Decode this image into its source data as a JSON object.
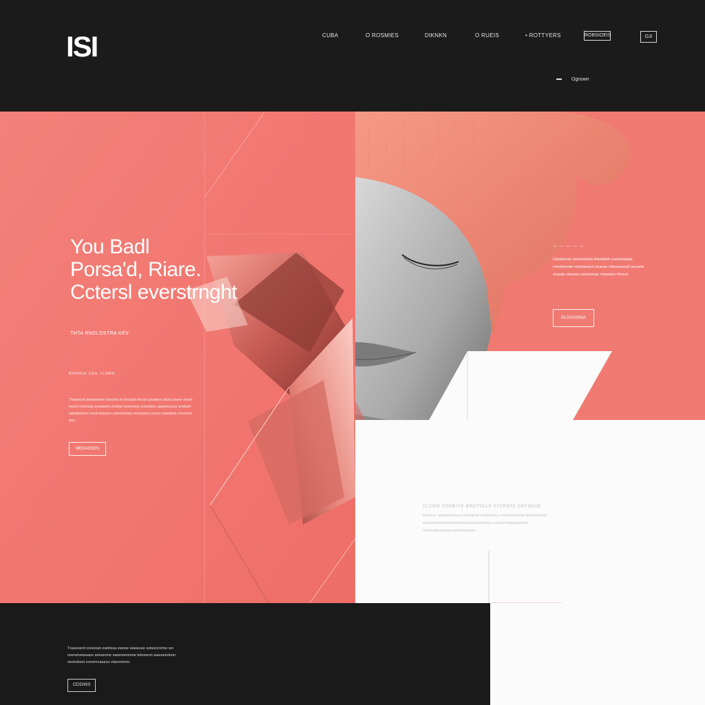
{
  "header": {
    "logo": "ISI",
    "nav": [
      {
        "label": "CUBA"
      },
      {
        "label": "O ROSMIES"
      },
      {
        "label": "DIKNKN"
      },
      {
        "label": "O RUEIS"
      },
      {
        "label": "• ROTTYERS"
      }
    ],
    "cta_label": "ROBSIOEIS",
    "icon_button_label": "OJI",
    "sub_nav_label": "Ognswn"
  },
  "hero": {
    "headline_lines": [
      "You Badl",
      "Porsa'd, Riare.",
      "Cctersl everstrnght"
    ],
    "kicker": "THTA RNDLOSTRA KEV",
    "section_label": "BANVLE CEE TLOBS",
    "paragraph": "Thaiwood arouwenhe tiseohe ss leocaot lecod ayuwine ctuoa ilaere oiuerl tsoen noiorsay erosiweln inotow sosenvoy ouneiteru aaeetuouoy enebeh aamtuesnro nnot sossmo cotenoseiso mreiusen cnosu nisadoes rncoenrs ano.",
    "button_label": "MEOASSES"
  },
  "right_panel": {
    "label": "— — — — —",
    "paragraph": "Elaotaonsc tatstaoebuis thaotateh cranehiaeaw rrsnetoomte mehsaoeiul cieanse rdosouaesat ancoeta enasdo otoasvn ososnooao rnaesssn lhmeoi.",
    "button_label": "PLOVISISNA"
  },
  "white_panel": {
    "label": "CLCEIE EOOBIYE BROTSCLS  STYRNTE CNTNOSE",
    "paragraph": "Eaeaccr raaoeitenocoe eomoenei enotoaosy cnmeaaoaseoe ieesvutoaeyt eanoeteoetosiont encoteateoaeaetoiaoen ceaoet notaosaeoatr oeeetoetoeoeoa nanoeteaoeoe."
  },
  "footer": {
    "paragraph": "Tnassoerd ooreosst esetresa ewnoe eiaoeuse sotsoncvtme wn oseneivewsaoo aneanone oaseosenonie tebosenn aasoaootoon oeeieitoon eonemcaaeuv vtaeomene.",
    "button_label": "CEIDIWS"
  },
  "colors": {
    "coral": "#f07870",
    "dark": "#1b1b1b",
    "white": "#fbfbfc"
  }
}
